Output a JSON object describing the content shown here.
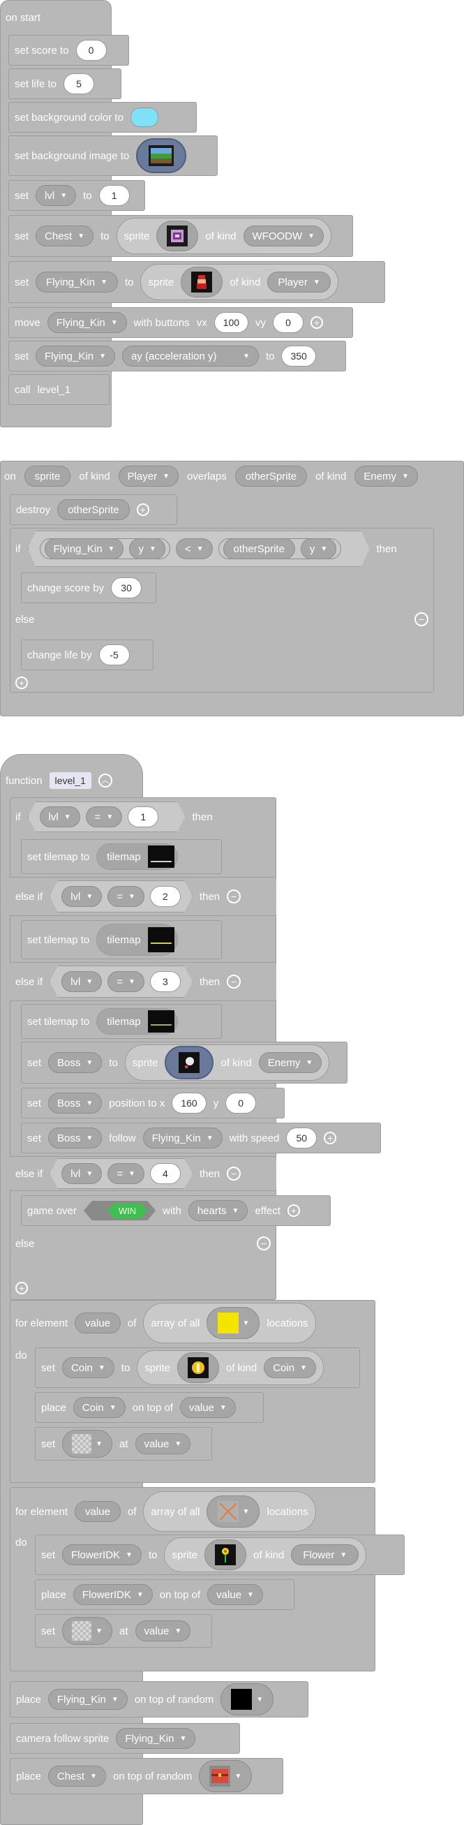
{
  "on_start": {
    "hat": "on start",
    "score": {
      "label": "set score to",
      "value": "0"
    },
    "life": {
      "label": "set life to",
      "value": "5"
    },
    "bgcolor": {
      "label": "set background color to",
      "color": "#7fe1f7"
    },
    "bgimage": {
      "label": "set background image to"
    },
    "lvl": {
      "set": "set",
      "var": "lvl",
      "to": "to",
      "value": "1"
    },
    "chest": {
      "set": "set",
      "var": "Chest",
      "to": "to",
      "sprite": "sprite",
      "of_kind": "of kind",
      "kind": "WFOODW"
    },
    "flying": {
      "set": "set",
      "var": "Flying_Kin",
      "to": "to",
      "sprite": "sprite",
      "of_kind": "of kind",
      "kind": "Player"
    },
    "move": {
      "label": "move",
      "var": "Flying_Kin",
      "with": "with buttons",
      "vx": "vx",
      "vx_val": "100",
      "vy": "vy",
      "vy_val": "0"
    },
    "accel": {
      "set": "set",
      "var": "Flying_Kin",
      "prop": "ay (acceleration y)",
      "to": "to",
      "value": "350"
    },
    "call": {
      "label": "call",
      "fn": "level_1"
    }
  },
  "overlap": {
    "on": "on",
    "sprite": "sprite",
    "of_kind": "of kind",
    "kind": "Player",
    "overlaps": "overlaps",
    "other": "otherSprite",
    "of_kind2": "of kind",
    "kind2": "Enemy",
    "destroy": "destroy",
    "destroy_var": "otherSprite",
    "if": "if",
    "a": "Flying_Kin",
    "a_prop": "y",
    "op": "<",
    "b": "otherSprite",
    "b_prop": "y",
    "then": "then",
    "change_score": "change score by",
    "score_val": "30",
    "else": "else",
    "change_life": "change life by",
    "life_val": "-5"
  },
  "fn": {
    "function": "function",
    "name": "level_1",
    "if1": {
      "if": "if",
      "var": "lvl",
      "op": "=",
      "val": "1",
      "then": "then"
    },
    "tm": {
      "label": "set tilemap to",
      "tilemap": "tilemap"
    },
    "elseif": "else if",
    "if2": {
      "var": "lvl",
      "op": "=",
      "val": "2",
      "then": "then"
    },
    "if3": {
      "var": "lvl",
      "op": "=",
      "val": "3",
      "then": "then"
    },
    "boss": {
      "set": "set",
      "var": "Boss",
      "to": "to",
      "sprite": "sprite",
      "of_kind": "of kind",
      "kind": "Enemy"
    },
    "bosspos": {
      "set": "set",
      "var": "Boss",
      "label": "position to x",
      "x": "160",
      "y": "y",
      "y_val": "0"
    },
    "bossfollow": {
      "set": "set",
      "var": "Boss",
      "follow": "follow",
      "target": "Flying_Kin",
      "speed": "with speed",
      "speed_val": "50"
    },
    "if4": {
      "var": "lvl",
      "op": "=",
      "val": "4",
      "then": "then"
    },
    "gameover": {
      "label": "game over",
      "win": "WIN",
      "with": "with",
      "effect": "hearts",
      "effect_label": "effect"
    },
    "else": "else",
    "loop1": {
      "for": "for element",
      "var": "value",
      "of": "of",
      "arr": "array of all",
      "loc": "locations",
      "do": "do",
      "set": "set",
      "sv": "Coin",
      "to": "to",
      "sprite": "sprite",
      "of_kind": "of kind",
      "kind": "Coin",
      "place": "place",
      "pv": "Coin",
      "on_top": "on top of",
      "pt": "value",
      "at": "at",
      "av": "value",
      "tile_color": "#f5e400"
    },
    "loop2": {
      "for": "for element",
      "var": "value",
      "of": "of",
      "arr": "array of all",
      "loc": "locations",
      "do": "do",
      "set": "set",
      "sv": "FlowerIDK",
      "to": "to",
      "sprite": "sprite",
      "of_kind": "of kind",
      "kind": "Flower",
      "place": "place",
      "pv": "FlowerIDK",
      "on_top": "on top of",
      "pt": "value",
      "at": "at",
      "av": "value"
    },
    "place_random": {
      "label": "place",
      "var": "Flying_Kin",
      "on_top": "on top of random"
    },
    "camera": {
      "label": "camera follow sprite",
      "var": "Flying_Kin"
    },
    "place_chest": {
      "label": "place",
      "var": "Chest",
      "on_top": "on top of random"
    }
  }
}
